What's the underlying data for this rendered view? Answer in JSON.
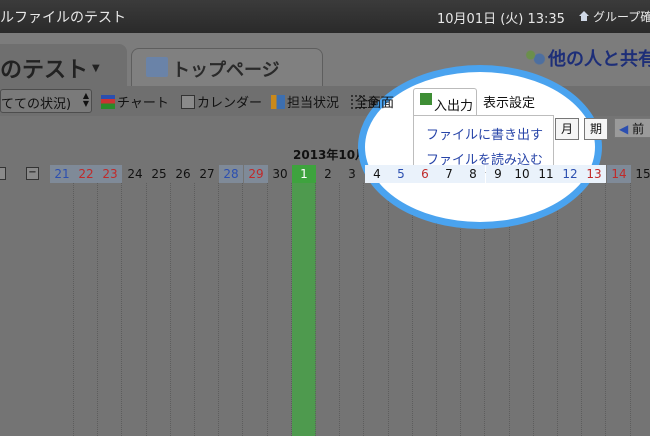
{
  "topbar": {
    "title": "ルファイルのテスト",
    "clock": "10月01日 (火) 13:35",
    "group": "グループ確"
  },
  "tabs": [
    {
      "label": "のテスト",
      "icon": "chevron-down-icon"
    },
    {
      "label": "トップページ",
      "icon": "page-icon"
    }
  ],
  "share_label": "他の人と共有",
  "toolbar": {
    "status_select": "てての状況)",
    "chart_label": "チャート",
    "calendar_label": "カレンダー",
    "staff_label": "担当状況",
    "fullscreen_label": "全画面",
    "io_label": "入出力",
    "display_settings_label": "表示設定",
    "month_button": "月",
    "period_button": "期",
    "prev_button": "前"
  },
  "io_menu": {
    "items": [
      "ファイルに書き出す",
      "ファイルを読み込む"
    ]
  },
  "calendar": {
    "month_label": "2013年10月",
    "days": [
      {
        "n": "21",
        "c": "#2c4fb0"
      },
      {
        "n": "22",
        "c": "#c02a2a"
      },
      {
        "n": "23",
        "c": "#c02a2a"
      },
      {
        "n": "24",
        "c": "#111"
      },
      {
        "n": "25",
        "c": "#111"
      },
      {
        "n": "26",
        "c": "#111"
      },
      {
        "n": "27",
        "c": "#111"
      },
      {
        "n": "28",
        "c": "#2c4fb0"
      },
      {
        "n": "29",
        "c": "#c02a2a"
      },
      {
        "n": "30",
        "c": "#111"
      },
      {
        "n": "1",
        "c": "#ffffff"
      },
      {
        "n": "2",
        "c": "#111"
      },
      {
        "n": "3",
        "c": "#111"
      },
      {
        "n": "4",
        "c": "#111"
      },
      {
        "n": "5",
        "c": "#2c4fb0"
      },
      {
        "n": "6",
        "c": "#c02a2a"
      },
      {
        "n": "7",
        "c": "#111"
      },
      {
        "n": "8",
        "c": "#111"
      },
      {
        "n": "9",
        "c": "#111"
      },
      {
        "n": "10",
        "c": "#111"
      },
      {
        "n": "11",
        "c": "#111"
      },
      {
        "n": "12",
        "c": "#2c4fb0"
      },
      {
        "n": "13",
        "c": "#c02a2a"
      },
      {
        "n": "14",
        "c": "#c02a2a"
      },
      {
        "n": "15",
        "c": "#111"
      }
    ],
    "today_index": 10
  },
  "colors": {
    "highlight_ring": "#4aa3ef",
    "today_green": "#3ea33e",
    "menu_link": "#2744a8"
  }
}
